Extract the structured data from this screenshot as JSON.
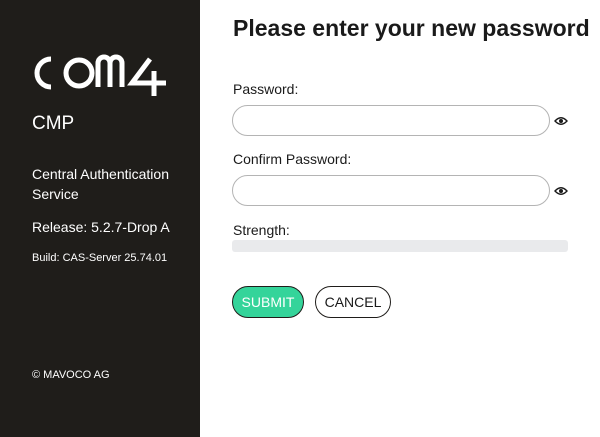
{
  "sidebar": {
    "logo_text": "COM4",
    "product": "CMP",
    "service": "Central Authentication Service",
    "release": "Release: 5.2.7-Drop A",
    "build": "Build: CAS-Server 25.74.01",
    "copyright": "© MAVOCO AG"
  },
  "form": {
    "title": "Please enter your new password",
    "password_label": "Password:",
    "password_value": "",
    "confirm_label": "Confirm Password:",
    "confirm_value": "",
    "strength_label": "Strength:",
    "strength_fraction": 0,
    "toggle_icon": "eye-icon",
    "submit_label": "SUBMIT",
    "cancel_label": "CANCEL"
  },
  "colors": {
    "sidebar_bg": "#1f1d1a",
    "accent": "#34d49a",
    "strength_track": "#e9eaec"
  }
}
